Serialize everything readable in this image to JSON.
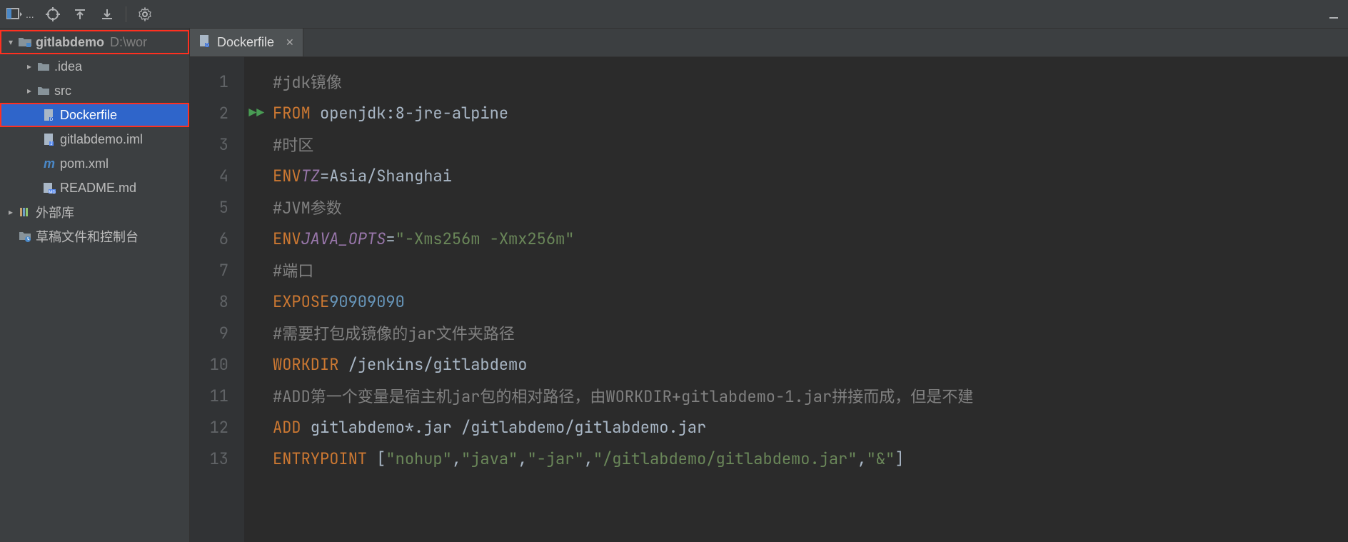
{
  "toolbar": {
    "icons": [
      "project-view-icon",
      "locate-icon",
      "expand-all-icon",
      "collapse-all-icon",
      "settings-icon",
      "hide-icon"
    ]
  },
  "project": {
    "name": "gitlabdemo",
    "path": "D:\\wor",
    "tree": {
      "idea": ".idea",
      "src": "src",
      "dockerfile": "Dockerfile",
      "iml": "gitlabdemo.iml",
      "pom": "pom.xml",
      "readme": "README.md",
      "extlib": "外部库",
      "scratch": "草稿文件和控制台"
    }
  },
  "tabs": {
    "active": "Dockerfile"
  },
  "editor": {
    "file": "Dockerfile",
    "lines": [
      {
        "n": 1,
        "type": "comment",
        "text": "#jdk镜像"
      },
      {
        "n": 2,
        "type": "from",
        "key": "FROM",
        "val": "openjdk:8-jre-alpine"
      },
      {
        "n": 3,
        "type": "comment",
        "text": "#时区"
      },
      {
        "n": 4,
        "type": "env",
        "key": "ENV",
        "var": "TZ",
        "val": "=Asia/Shanghai"
      },
      {
        "n": 5,
        "type": "comment",
        "text": "#JVM参数"
      },
      {
        "n": 6,
        "type": "envq",
        "key": "ENV",
        "var": "JAVA_OPTS",
        "eq": "=",
        "str": "\"-Xms256m -Xmx256m\""
      },
      {
        "n": 7,
        "type": "comment",
        "text": "#端口"
      },
      {
        "n": 8,
        "type": "expose",
        "key": "EXPOSE",
        "n1": "9090",
        "n2": "9090"
      },
      {
        "n": 9,
        "type": "comment",
        "text": "#需要打包成镜像的jar文件夹路径"
      },
      {
        "n": 10,
        "type": "workdir",
        "key": "WORKDIR",
        "val": "/jenkins/gitlabdemo"
      },
      {
        "n": 11,
        "type": "comment",
        "text": "#ADD第一个变量是宿主机jar包的相对路径，由WORKDIR+gitlabdemo-1.jar拼接而成，但是不建"
      },
      {
        "n": 12,
        "type": "add",
        "key": "ADD",
        "val": "gitlabdemo*.jar /gitlabdemo/gitlabdemo.jar"
      },
      {
        "n": 13,
        "type": "entry",
        "key": "ENTRYPOINT",
        "parts": [
          "[",
          "\"nohup\"",
          ",",
          "\"java\"",
          ",",
          "\"-jar\"",
          ",",
          "\"/gitlabdemo/gitlabdemo.jar\"",
          ",",
          "\"&\"",
          "]"
        ]
      }
    ]
  }
}
